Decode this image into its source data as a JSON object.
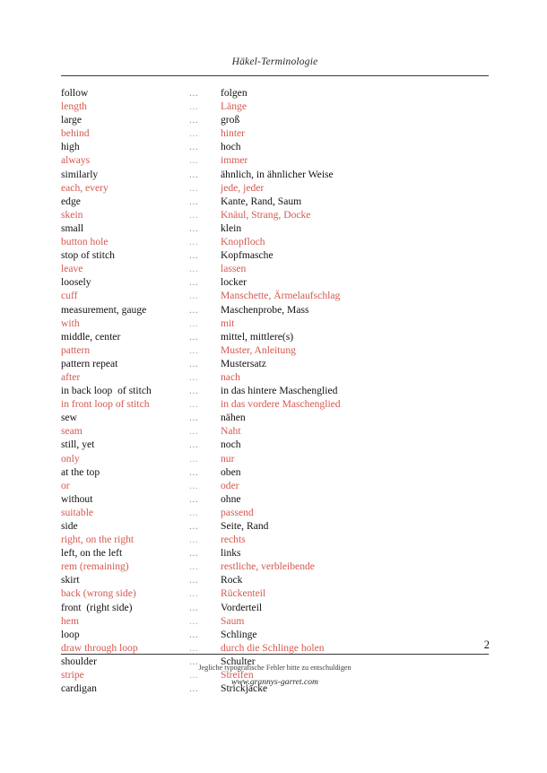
{
  "document": {
    "header_title": "Häkel-Terminologie",
    "page_number": "2",
    "footer_note": "Jegliche typografische Fehler bitte zu entschuldigen",
    "footer_url": "www.grannys-garret.com",
    "separator": "...",
    "colors": {
      "red": "#d4594f",
      "black": "#111111",
      "rule": "#3a3a3a",
      "page_background": "#ffffff"
    }
  },
  "glossary": {
    "rows": [
      {
        "en": "follow",
        "de": "folgen",
        "color": "black"
      },
      {
        "en": "length",
        "de": "Länge",
        "color": "red"
      },
      {
        "en": "large",
        "de": "groß",
        "color": "black"
      },
      {
        "en": "behind",
        "de": "hinter",
        "color": "red"
      },
      {
        "en": "high",
        "de": "hoch",
        "color": "black"
      },
      {
        "en": "always",
        "de": "immer",
        "color": "red"
      },
      {
        "en": "similarly",
        "de": "ähnlich, in ähnlicher Weise",
        "color": "black"
      },
      {
        "en": "each, every",
        "de": "jede, jeder",
        "color": "red"
      },
      {
        "en": "edge",
        "de": "Kante, Rand, Saum",
        "color": "black"
      },
      {
        "en": "skein",
        "de": "Knäul, Strang, Docke",
        "color": "red"
      },
      {
        "en": "small",
        "de": "klein",
        "color": "black"
      },
      {
        "en": "button hole",
        "de": "Knopfloch",
        "color": "red"
      },
      {
        "en": "stop of stitch",
        "de": "Kopfmasche",
        "color": "black"
      },
      {
        "en": "leave",
        "de": "lassen",
        "color": "red"
      },
      {
        "en": "loosely",
        "de": "locker",
        "color": "black"
      },
      {
        "en": "cuff",
        "de": "Manschette, Ärmelaufschlag",
        "color": "red"
      },
      {
        "en": "measurement, gauge",
        "de": "Maschenprobe, Mass",
        "color": "black"
      },
      {
        "en": "with",
        "de": "mit",
        "color": "red"
      },
      {
        "en": "middle, center",
        "de": "mittel, mittlere(s)",
        "color": "black"
      },
      {
        "en": "pattern",
        "de": "Muster, Anleitung",
        "color": "red"
      },
      {
        "en": "pattern repeat",
        "de": "Mustersatz",
        "color": "black"
      },
      {
        "en": "after",
        "de": "nach",
        "color": "red"
      },
      {
        "en": "in back loop  of stitch",
        "de": "in das hintere Maschenglied",
        "color": "black"
      },
      {
        "en": "in front loop of stitch",
        "de": "in das vordere Maschenglied",
        "color": "red"
      },
      {
        "en": "sew",
        "de": "nähen",
        "color": "black"
      },
      {
        "en": "seam",
        "de": "Naht",
        "color": "red"
      },
      {
        "en": "still, yet",
        "de": "noch",
        "color": "black"
      },
      {
        "en": "only",
        "de": "nur",
        "color": "red"
      },
      {
        "en": "at the top",
        "de": "oben",
        "color": "black"
      },
      {
        "en": "or",
        "de": "oder",
        "color": "red"
      },
      {
        "en": "without",
        "de": "ohne",
        "color": "black"
      },
      {
        "en": "suitable",
        "de": "passend",
        "color": "red"
      },
      {
        "en": "side",
        "de": "Seite, Rand",
        "color": "black"
      },
      {
        "en": "right, on the right",
        "de": "rechts",
        "color": "red"
      },
      {
        "en": "left, on the left",
        "de": "links",
        "color": "black"
      },
      {
        "en": "rem (remaining)",
        "de": "restliche, verbleibende",
        "color": "red"
      },
      {
        "en": "skirt",
        "de": "Rock",
        "color": "black"
      },
      {
        "en": "back (wrong side)",
        "de": "Rückenteil",
        "color": "red"
      },
      {
        "en": "front  (right side)",
        "de": "Vorderteil",
        "color": "black"
      },
      {
        "en": "hem",
        "de": "Saum",
        "color": "red"
      },
      {
        "en": "loop",
        "de": "Schlinge",
        "color": "black"
      },
      {
        "en": "draw through loop",
        "de": "durch die Schlinge holen",
        "color": "red"
      },
      {
        "en": "shoulder",
        "de": "Schulter",
        "color": "black"
      },
      {
        "en": "stripe",
        "de": "Streifen",
        "color": "red"
      },
      {
        "en": "cardigan",
        "de": "Strickjacke",
        "color": "black"
      }
    ]
  }
}
